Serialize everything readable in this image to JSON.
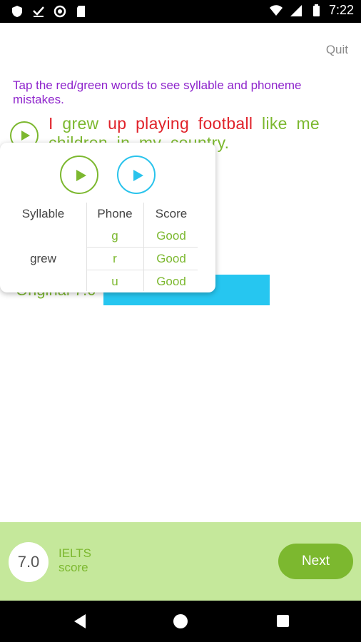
{
  "status_bar": {
    "time": "7:22",
    "icons_left": [
      "shield-icon",
      "download-done-icon",
      "circle-icon",
      "sd-card-icon"
    ],
    "icons_right": [
      "wifi-icon",
      "signal-icon",
      "battery-icon"
    ]
  },
  "header": {
    "quit_label": "Quit"
  },
  "instruction": "Tap the red/green words to see syllable and phoneme mistakes.",
  "sentence": {
    "words": [
      {
        "text": "I",
        "status": "red"
      },
      {
        "text": "grew",
        "status": "green"
      },
      {
        "text": "up",
        "status": "red"
      },
      {
        "text": "playing",
        "status": "red"
      },
      {
        "text": "football",
        "status": "red"
      },
      {
        "text": "like",
        "status": "green"
      },
      {
        "text": "me",
        "status": "green"
      },
      {
        "text": "children",
        "status": "green"
      },
      {
        "text": "in",
        "status": "green"
      },
      {
        "text": "my",
        "status": "green"
      },
      {
        "text": "country.",
        "status": "green"
      }
    ]
  },
  "background_result": {
    "label": "Original 7.0"
  },
  "popup": {
    "headers": {
      "syllable": "Syllable",
      "phone": "Phone",
      "score": "Score"
    },
    "syllable": "grew",
    "rows": [
      {
        "phone": "g",
        "score": "Good"
      },
      {
        "phone": "r",
        "score": "Good"
      },
      {
        "phone": "u",
        "score": "Good"
      }
    ]
  },
  "footer": {
    "score_value": "7.0",
    "score_label_line1": "IELTS",
    "score_label_line2": "score",
    "next_label": "Next"
  },
  "colors": {
    "green": "#7cb82f",
    "red": "#e0222a",
    "purple": "#8e24cc",
    "blue": "#26c6f0",
    "bottom_bg": "#c5e89b"
  }
}
